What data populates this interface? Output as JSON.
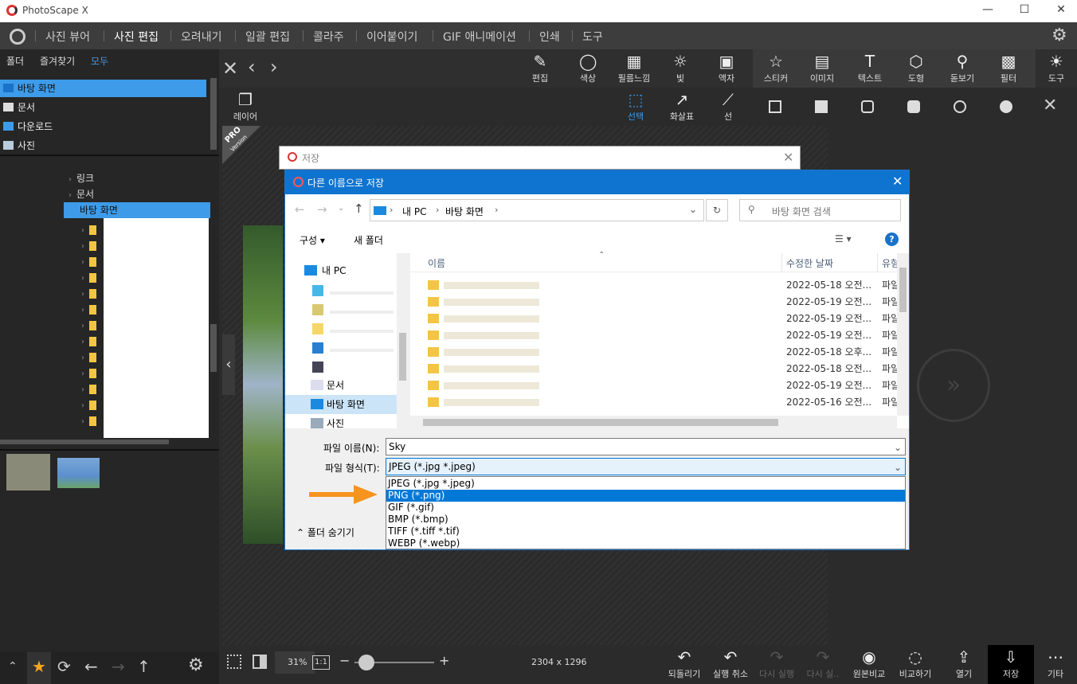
{
  "app": {
    "title": "PhotoScape X"
  },
  "menu": [
    "사진 뷰어",
    "사진 편집",
    "오려내기",
    "일괄 편집",
    "콜라주",
    "이어붙이기",
    "GIF 애니메이션",
    "인쇄",
    "도구"
  ],
  "left_tabs": [
    "폴더",
    "즐겨찾기",
    "모두"
  ],
  "quick_access": [
    "바탕 화면",
    "문서",
    "다운로드",
    "사진"
  ],
  "tree": {
    "link": "링크",
    "docs": "문서",
    "desktop": "바탕 화면"
  },
  "toolbar": [
    "편집",
    "색상",
    "필름느낌",
    "빛",
    "액자",
    "스티커",
    "이미지",
    "텍스트",
    "도형",
    "돋보기",
    "필터",
    "도구"
  ],
  "subtool": {
    "layer": "레이어",
    "select": "선택",
    "arrow": "화살표",
    "line": "선"
  },
  "pro_badge": {
    "main": "PRO",
    "sub": "Version"
  },
  "bottom": {
    "zoom": "31%",
    "ratio": "1:1",
    "dimensions": "2304 x 1296",
    "actions": [
      "되돌리기",
      "실행 취소",
      "다시 실행",
      "다시 실..",
      "원본비교",
      "비교하기",
      "열기",
      "저장",
      "기타"
    ]
  },
  "save_dialog": {
    "title": "저장"
  },
  "saveas": {
    "title": "다른 이름으로 저장",
    "breadcrumb": [
      "내 PC",
      "바탕 화면"
    ],
    "search_placeholder": "바탕 화면 검색",
    "organize": "구성",
    "new_folder": "새 폴더",
    "columns": {
      "name": "이름",
      "date": "수정한 날짜",
      "type": "유형"
    },
    "nav_items": [
      "내 PC",
      "문서",
      "바탕 화면",
      "사진"
    ],
    "file_dates": [
      "2022-05-18 오전...",
      "2022-05-19 오전...",
      "2022-05-19 오전...",
      "2022-05-19 오전...",
      "2022-05-18 오후...",
      "2022-05-18 오전...",
      "2022-05-19 오전...",
      "2022-05-16 오전..."
    ],
    "file_type": "파일",
    "filename_label": "파일 이름(N):",
    "filename_value": "Sky",
    "filetype_label": "파일 형식(T):",
    "filetype_value": "JPEG (*.jpg *.jpeg)",
    "options": [
      "JPEG (*.jpg *.jpeg)",
      "PNG (*.png)",
      "GIF (*.gif)",
      "BMP (*.bmp)",
      "TIFF (*.tiff *.tif)",
      "WEBP (*.webp)"
    ],
    "hide_folders": "폴더 숨기기"
  },
  "colors": {
    "accent": "#3d9be9",
    "dialog_header": "#0f74d0",
    "selection": "#0078d7",
    "arrow": "#f7941d"
  }
}
